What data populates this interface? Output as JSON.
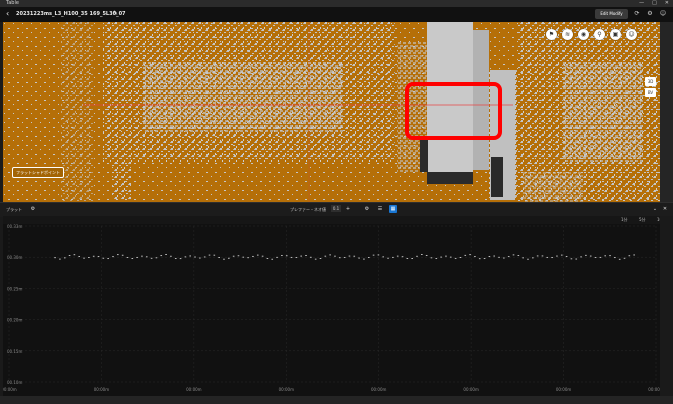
{
  "app": {
    "title": "Table",
    "window_controls": [
      "—",
      "□",
      "✕"
    ]
  },
  "header": {
    "back": "‹",
    "file_title": "20231223ms_L3_H100_35 169_5L30_07",
    "edit_label": "Edit Modify",
    "icons": [
      "cycle-icon",
      "settings-icon",
      "user-icon"
    ]
  },
  "viewport": {
    "point_tag": "フラットシャドポイント",
    "tools": [
      "pin-icon",
      "layers-icon",
      "location-icon",
      "measure-icon",
      "capture-icon",
      "user-icon"
    ],
    "view_buttons": [
      "3D",
      "BV"
    ],
    "colors": {
      "ground": "#b56f08",
      "points": "#c6c6c6"
    }
  },
  "panel": {
    "name": "プラット",
    "control_label": "プレファー・ネオ値",
    "control_value": "0.1",
    "ranges": [
      "1分",
      "5分",
      "10分"
    ],
    "icons": [
      "settings-icon",
      "list-icon",
      "chart-icon"
    ]
  },
  "chart_data": {
    "type": "scatter",
    "y_ticks": [
      "00.33m",
      "00.30m",
      "00.25m",
      "00.20m",
      "00.15m",
      "00.10m"
    ],
    "x_ticks": [
      "00:00m",
      "00:00m",
      "00:00m",
      "00:00m",
      "00:00m",
      "00:00m",
      "00:00m",
      "00:00m"
    ],
    "ylim": [
      0.1,
      0.33
    ],
    "y_level": 0.285,
    "x_range": [
      0.07,
      0.965
    ],
    "grid": true
  }
}
